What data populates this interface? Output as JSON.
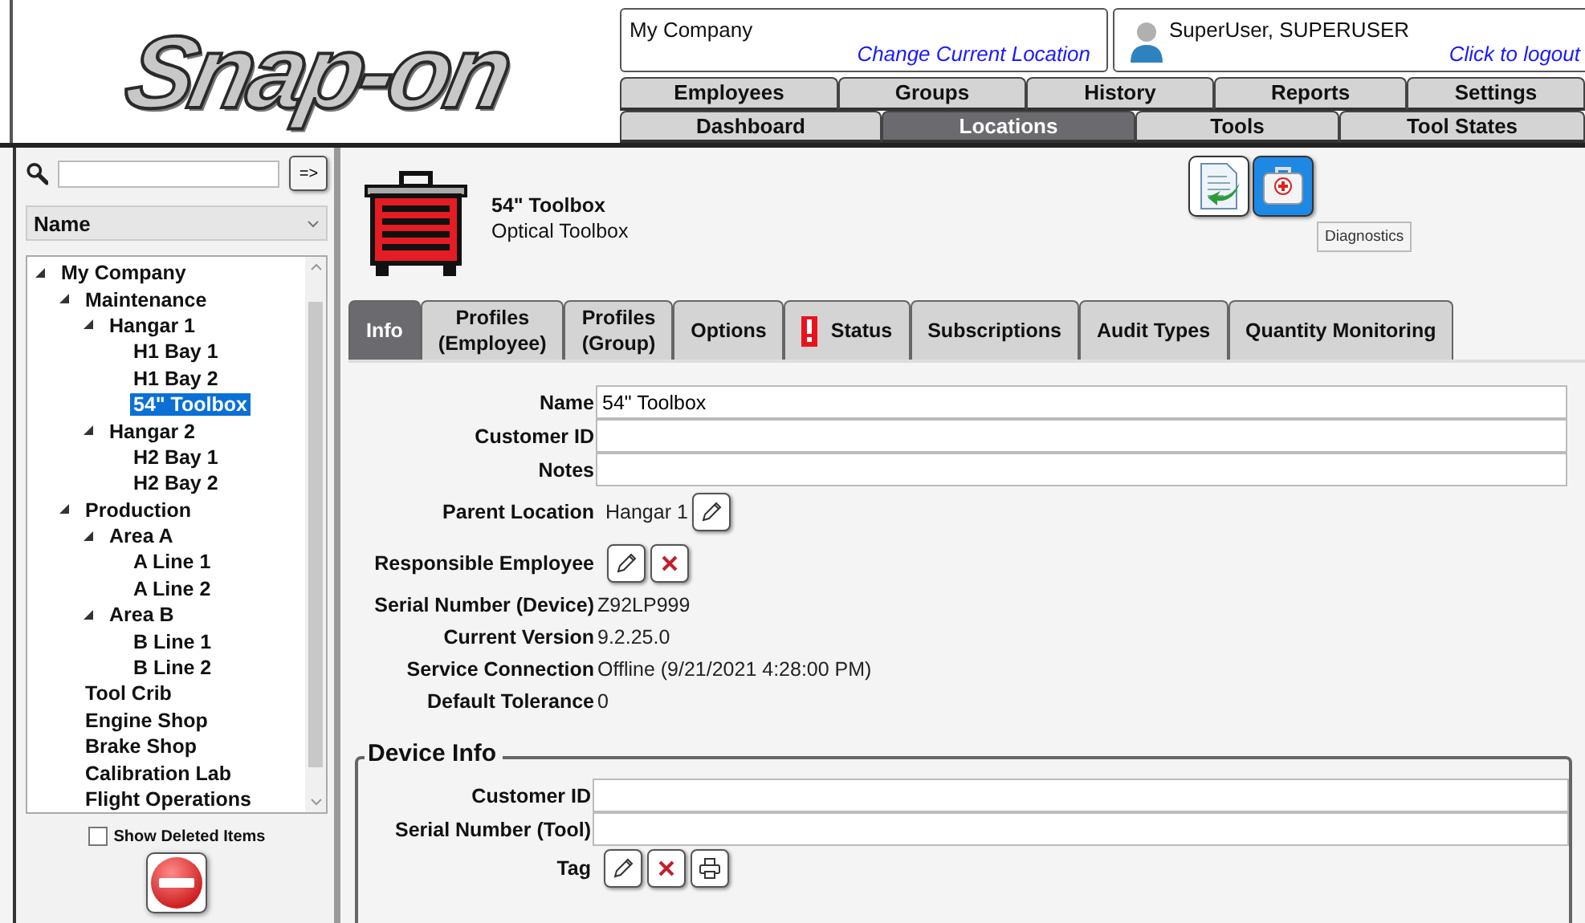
{
  "logo": {
    "text": "Snap-on"
  },
  "location": {
    "name": "My Company",
    "link": "Change Current Location"
  },
  "user": {
    "name": "SuperUser, SUPERUSER",
    "link": "Click to logout"
  },
  "nav_rows": [
    [
      {
        "label": "Employees",
        "selected": false
      },
      {
        "label": "Groups",
        "selected": false
      },
      {
        "label": "History",
        "selected": false
      },
      {
        "label": "Reports",
        "selected": false
      },
      {
        "label": "Settings",
        "selected": false
      }
    ],
    [
      {
        "label": "Dashboard",
        "selected": false
      },
      {
        "label": "Locations",
        "selected": true
      },
      {
        "label": "Tools",
        "selected": false
      },
      {
        "label": "Tool States",
        "selected": false
      }
    ]
  ],
  "sidebar": {
    "go_button": "=>",
    "sort": "Name",
    "tree": [
      {
        "label": "My Company",
        "expanded": true,
        "selected": false,
        "children": [
          {
            "label": "Maintenance",
            "expanded": true,
            "selected": false,
            "children": [
              {
                "label": "Hangar 1",
                "expanded": true,
                "selected": false,
                "children": [
                  {
                    "label": "H1 Bay 1",
                    "selected": false
                  },
                  {
                    "label": "H1 Bay 2",
                    "selected": false
                  },
                  {
                    "label": "54\" Toolbox",
                    "selected": true
                  }
                ]
              },
              {
                "label": "Hangar 2",
                "expanded": true,
                "selected": false,
                "children": [
                  {
                    "label": "H2 Bay 1",
                    "selected": false
                  },
                  {
                    "label": "H2 Bay 2",
                    "selected": false
                  }
                ]
              }
            ]
          },
          {
            "label": "Production",
            "expanded": true,
            "selected": false,
            "children": [
              {
                "label": "Area A",
                "expanded": true,
                "selected": false,
                "children": [
                  {
                    "label": "A Line 1",
                    "selected": false
                  },
                  {
                    "label": "A Line 2",
                    "selected": false
                  }
                ]
              },
              {
                "label": "Area B",
                "expanded": true,
                "selected": false,
                "children": [
                  {
                    "label": "B Line 1",
                    "selected": false
                  },
                  {
                    "label": "B Line 2",
                    "selected": false
                  }
                ]
              }
            ]
          },
          {
            "label": "Tool Crib",
            "selected": false
          },
          {
            "label": "Engine Shop",
            "selected": false
          },
          {
            "label": "Brake Shop",
            "selected": false
          },
          {
            "label": "Calibration Lab",
            "selected": false
          },
          {
            "label": "Flight Operations",
            "selected": false
          }
        ]
      }
    ],
    "show_deleted": {
      "label": "Show Deleted Items",
      "checked": false
    }
  },
  "item": {
    "name": "54\" Toolbox",
    "type": "Optical Toolbox"
  },
  "toolbar": {
    "buttons": [
      {
        "kind": "report",
        "hovered": false
      },
      {
        "kind": "diagnostics",
        "hovered": true
      }
    ],
    "tooltip": "Diagnostics"
  },
  "tabs": [
    {
      "label": "Info",
      "selected": true,
      "alert": false
    },
    {
      "label": "Profiles\n(Employee)",
      "selected": false,
      "alert": false
    },
    {
      "label": "Profiles\n(Group)",
      "selected": false,
      "alert": false
    },
    {
      "label": "Options",
      "selected": false,
      "alert": false
    },
    {
      "label": "Status",
      "selected": false,
      "alert": true
    },
    {
      "label": "Subscriptions",
      "selected": false,
      "alert": false
    },
    {
      "label": "Audit Types",
      "selected": false,
      "alert": false
    },
    {
      "label": "Quantity Monitoring",
      "selected": false,
      "alert": false
    }
  ],
  "fields": [
    {
      "label": "Name",
      "kind": "input",
      "value": "54\" Toolbox"
    },
    {
      "label": "Customer ID",
      "kind": "input"
    },
    {
      "label": "Notes",
      "kind": "input"
    },
    {
      "label": "Parent Location",
      "kind": "picker",
      "value": "Hangar 1",
      "actions": [
        {
          "kind": "edit"
        }
      ]
    },
    {
      "label": "Responsible Employee",
      "kind": "picker",
      "actions": [
        {
          "kind": "edit"
        },
        {
          "kind": "clear"
        }
      ]
    },
    {
      "label": "Serial Number (Device)",
      "kind": "text",
      "value": "Z92LP999"
    },
    {
      "label": "Current Version",
      "kind": "text",
      "value": "9.2.25.0"
    },
    {
      "label": "Service Connection",
      "kind": "text",
      "value": "Offline (9/21/2021 4:28:00 PM)"
    },
    {
      "label": "Default Tolerance",
      "kind": "text",
      "value": "0"
    }
  ],
  "device_info": {
    "title": "Device Info",
    "fields": [
      {
        "label": "Customer ID",
        "kind": "input"
      },
      {
        "label": "Serial Number (Tool)",
        "kind": "input"
      },
      {
        "label": "Tag",
        "kind": "picker",
        "actions": [
          {
            "kind": "edit"
          },
          {
            "kind": "clear"
          },
          {
            "kind": "print"
          }
        ]
      }
    ]
  }
}
